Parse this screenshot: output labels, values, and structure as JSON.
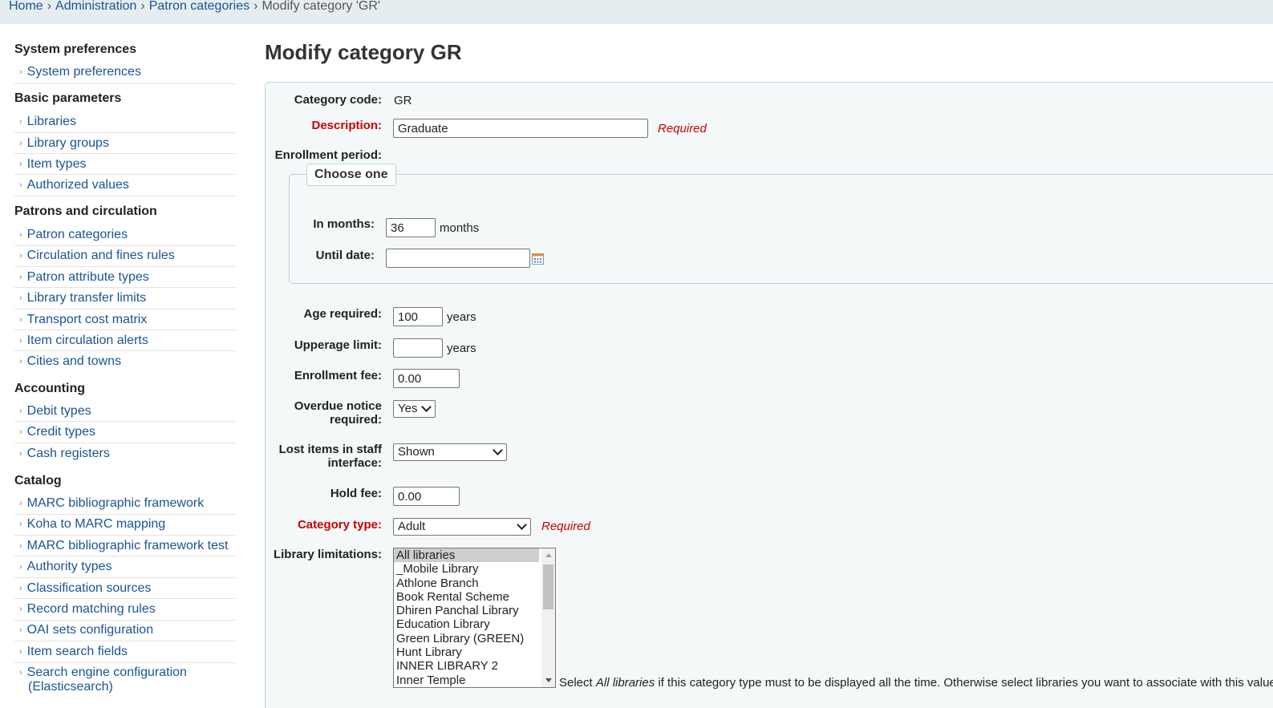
{
  "breadcrumb": {
    "home": "Home",
    "administration": "Administration",
    "patron_categories": "Patron categories",
    "current": "Modify category 'GR'",
    "separator": "›"
  },
  "sidebar": {
    "sections": [
      {
        "heading": "System preferences",
        "items": [
          "System preferences"
        ]
      },
      {
        "heading": "Basic parameters",
        "items": [
          "Libraries",
          "Library groups",
          "Item types",
          "Authorized values"
        ]
      },
      {
        "heading": "Patrons and circulation",
        "items": [
          "Patron categories",
          "Circulation and fines rules",
          "Patron attribute types",
          "Library transfer limits",
          "Transport cost matrix",
          "Item circulation alerts",
          "Cities and towns"
        ]
      },
      {
        "heading": "Accounting",
        "items": [
          "Debit types",
          "Credit types",
          "Cash registers"
        ]
      },
      {
        "heading": "Catalog",
        "items": [
          "MARC bibliographic framework",
          "Koha to MARC mapping",
          "MARC bibliographic framework test",
          "Authority types",
          "Classification sources",
          "Record matching rules",
          "OAI sets configuration",
          "Item search fields",
          "Search engine configuration",
          "(Elasticsearch)"
        ]
      }
    ]
  },
  "page_title": "Modify category GR",
  "form": {
    "category_code_label": "Category code:",
    "category_code_value": "GR",
    "description_label": "Description:",
    "description_value": "Graduate",
    "required_text": "Required",
    "enrollment_period_label": "Enrollment period:",
    "choose_one": "Choose one",
    "in_months_label": "In months:",
    "in_months_value": "36",
    "months_unit": "months",
    "until_date_label": "Until date:",
    "until_date_value": "",
    "age_required_label": "Age required:",
    "age_required_value": "100",
    "years_unit": "years",
    "upperage_label": "Upperage limit:",
    "upperage_value": "",
    "enrollment_fee_label": "Enrollment fee:",
    "enrollment_fee_value": "0.00",
    "overdue_label_1": "Overdue notice",
    "overdue_label_2": "required:",
    "overdue_value": "Yes",
    "lost_items_label_1": "Lost items in staff",
    "lost_items_label_2": "interface:",
    "lost_items_value": "Shown",
    "hold_fee_label": "Hold fee:",
    "hold_fee_value": "0.00",
    "category_type_label": "Category type:",
    "category_type_value": "Adult",
    "library_limitations_label": "Library limitations:",
    "library_options": [
      "All libraries",
      "_Mobile Library",
      "Athlone Branch",
      "Book Rental Scheme",
      "Dhiren Panchal Library",
      "Education Library",
      "Green Library (GREEN)",
      "Hunt Library",
      "INNER LIBRARY 2",
      "Inner Temple"
    ],
    "library_hint_pre": "Select ",
    "library_hint_em": "All libraries",
    "library_hint_post": " if this category type must to be displayed all the time. Otherwise select libraries you want to associate with this value."
  },
  "colors": {
    "link": "#1a5493",
    "required": "#cc0000",
    "panel_bg": "#f4f8f9",
    "breadcrumb_bg": "#e6edf0"
  }
}
